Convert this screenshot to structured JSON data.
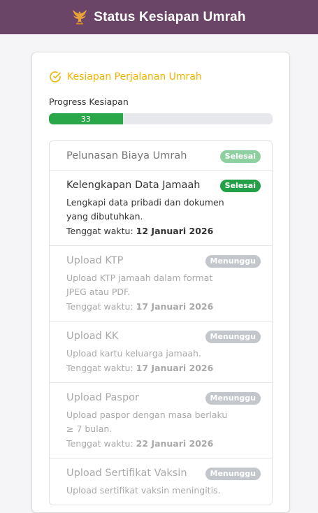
{
  "header": {
    "title": "Status Kesiapan Umrah",
    "logo_icon": "garuda-emblem-icon"
  },
  "card": {
    "title": "Kesiapan Perjalanan Umrah",
    "title_icon": "check-circle-icon",
    "progress": {
      "label": "Progress Kesiapan",
      "value": 33,
      "value_text": "33",
      "color": "#2aa748"
    }
  },
  "due_label": "Tenggat waktu:",
  "steps": [
    {
      "title": "Pelunasan Biaya Umrah",
      "status": "Selesai",
      "state": "done"
    },
    {
      "title": "Kelengkapan Data Jamaah",
      "status": "Selesai",
      "state": "active",
      "desc": "Lengkapi data pribadi dan dokumen yang dibutuhkan.",
      "due": "12 Januari 2026"
    },
    {
      "title": "Upload KTP",
      "status": "Menunggu",
      "state": "waiting",
      "desc": "Upload KTP jamaah dalam format JPEG atau PDF.",
      "due": "17 Januari 2026"
    },
    {
      "title": "Upload KK",
      "status": "Menunggu",
      "state": "waiting",
      "desc": "Upload kartu keluarga jamaah.",
      "due": "17 Januari 2026"
    },
    {
      "title": "Upload Paspor",
      "status": "Menunggu",
      "state": "waiting",
      "desc": "Upload paspor dengan masa berlaku ≥ 7 bulan.",
      "due": "22 Januari 2026"
    },
    {
      "title": "Upload Sertifikat Vaksin",
      "status": "Menunggu",
      "state": "waiting",
      "desc": "Upload sertifikat vaksin meningitis.",
      "due": ""
    }
  ]
}
